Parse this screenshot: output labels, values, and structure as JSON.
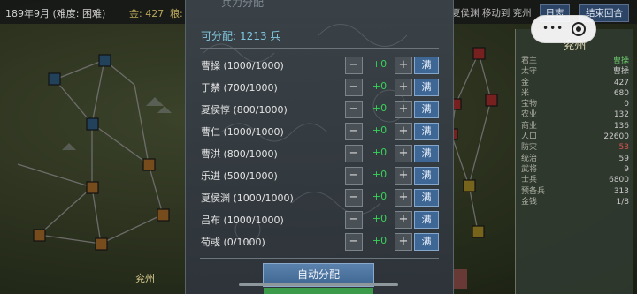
{
  "topbar": {
    "date": "189年9月 (难度: 困难)",
    "gold": "金: 427",
    "grain": "粮:",
    "move_hint": "夏侯渊 移动到 兖州",
    "log_button": "日志",
    "end_turn_button": "结束回合"
  },
  "info_panel": {
    "title": "兖州",
    "rows": [
      {
        "label": "君主",
        "value": "曹操",
        "color": "green"
      },
      {
        "label": "太守",
        "value": "曹操",
        "color": ""
      },
      {
        "label": "金",
        "value": "427",
        "color": ""
      },
      {
        "label": "米",
        "value": "680",
        "color": ""
      },
      {
        "label": "宝物",
        "value": "0",
        "color": ""
      },
      {
        "label": "农业",
        "value": "132",
        "color": ""
      },
      {
        "label": "商业",
        "value": "136",
        "color": ""
      },
      {
        "label": "人口",
        "value": "22600",
        "color": ""
      },
      {
        "label": "防灾",
        "value": "53",
        "color": "red"
      },
      {
        "label": "统治",
        "value": "59",
        "color": ""
      },
      {
        "label": "武将",
        "value": "9",
        "color": ""
      },
      {
        "label": "士兵",
        "value": "6800",
        "color": ""
      },
      {
        "label": "预备兵",
        "value": "313",
        "color": ""
      },
      {
        "label": "金钱",
        "value": "1/8",
        "color": ""
      }
    ]
  },
  "map": {
    "bottom_city": "兖州"
  },
  "modal": {
    "title": "兵力分配",
    "allot_label": "可分配:",
    "allot_value": "1213 兵",
    "minus": "−",
    "plus": "+",
    "max": "满",
    "generals": [
      {
        "name": "曹操 (1000/1000)",
        "delta": "+0"
      },
      {
        "name": "于禁 (700/1000)",
        "delta": "+0"
      },
      {
        "name": "夏侯惇 (800/1000)",
        "delta": "+0"
      },
      {
        "name": "曹仁 (1000/1000)",
        "delta": "+0"
      },
      {
        "name": "曹洪 (800/1000)",
        "delta": "+0"
      },
      {
        "name": "乐进 (500/1000)",
        "delta": "+0"
      },
      {
        "name": "夏侯渊 (1000/1000)",
        "delta": "+0"
      },
      {
        "name": "吕布 (1000/1000)",
        "delta": "+0"
      },
      {
        "name": "荀彧 (0/1000)",
        "delta": "+0"
      }
    ],
    "auto_button": "自动分配"
  },
  "colors": {
    "accent_blue": "#3f6795",
    "delta_green": "#39d25a",
    "allot_cyan": "#7fc7e0"
  }
}
